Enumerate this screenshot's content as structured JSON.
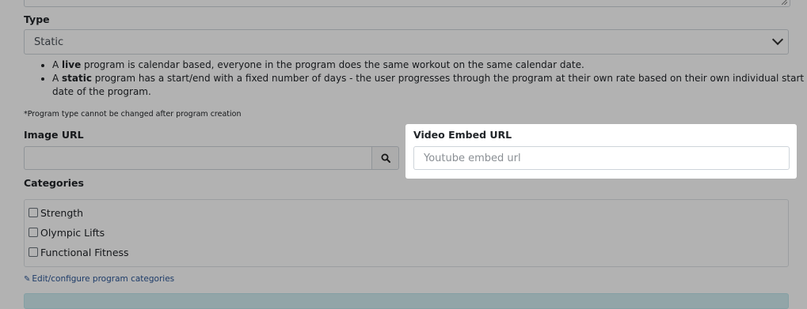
{
  "type_field": {
    "label": "Type",
    "selected": "Static"
  },
  "type_help": {
    "live_prefix": "A ",
    "live_term": "live",
    "live_text": " program is calendar based, everyone in the program does the same workout on the same calendar date.",
    "static_prefix": "A ",
    "static_term": "static",
    "static_text": " program has a start/end with a fixed number of days - the user progresses through the program at their own rate based on their own individual start date of the program."
  },
  "type_note": "*Program type cannot be changed after program creation",
  "image_url": {
    "label": "Image URL",
    "value": "",
    "search_icon": "search-icon"
  },
  "video_embed": {
    "label": "Video Embed URL",
    "placeholder": "Youtube embed url"
  },
  "categories": {
    "label": "Categories",
    "items": [
      {
        "label": "Strength",
        "checked": false
      },
      {
        "label": "Olympic Lifts",
        "checked": false
      },
      {
        "label": "Functional Fitness",
        "checked": false
      }
    ],
    "edit_link": "Edit/configure program categories",
    "edit_icon": "edit-icon"
  },
  "colors": {
    "link": "#2b5797",
    "info_bar": "#d1ecf1"
  }
}
